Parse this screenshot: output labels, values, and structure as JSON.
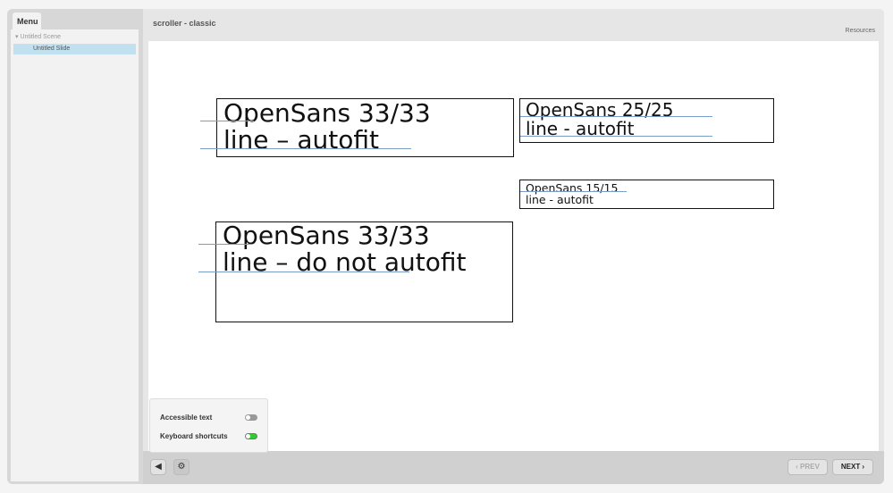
{
  "sidebar": {
    "tab_label": "Menu",
    "scene": "Untitled Scene",
    "slide": "Untitled Slide"
  },
  "header": {
    "title": "scroller - classic",
    "resources": "Resources"
  },
  "slide": {
    "box1": [
      "OpenSans 33/33",
      "line – autofit"
    ],
    "box2": [
      "OpenSans 25/25",
      "line - autofit"
    ],
    "box3": [
      "OpenSans 15/15",
      "line - autofit"
    ],
    "box4": [
      "OpenSans 33/33",
      "line – do not autofit"
    ]
  },
  "settings": {
    "accessible_text": "Accessible text",
    "accessible_on": false,
    "keyboard_shortcuts": "Keyboard shortcuts",
    "keyboard_on": true
  },
  "nav": {
    "prev": "‹ PREV",
    "next": "NEXT ›"
  },
  "colors": {
    "toggle_on": "#2ecc2e",
    "selected": "#c1e1f0"
  }
}
